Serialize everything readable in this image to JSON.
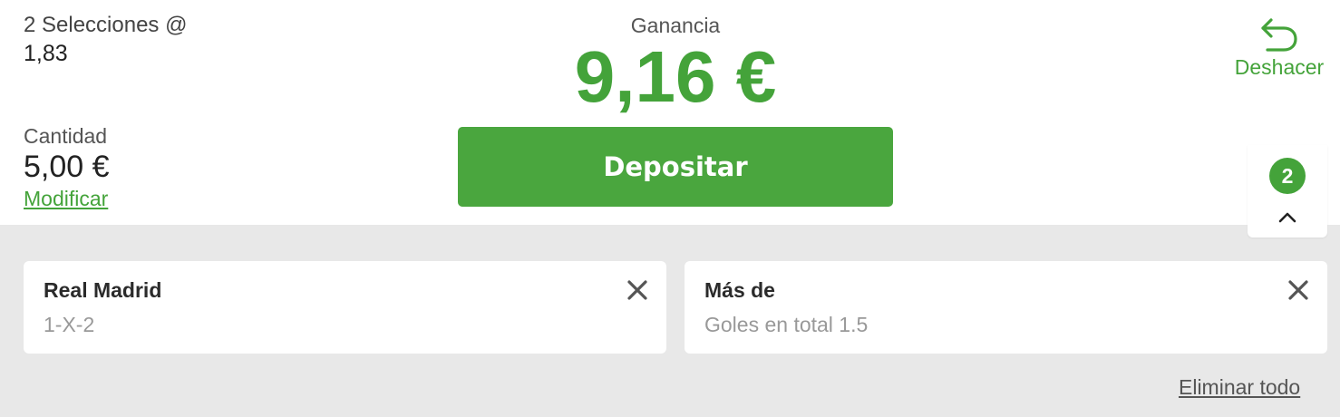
{
  "summary": {
    "selections_label": "2 Selecciones @",
    "odds": "1,83",
    "amount_label": "Cantidad",
    "amount_value": "5,00 €",
    "modify_label": "Modificar"
  },
  "winnings": {
    "label": "Ganancia",
    "value": "9,16 €"
  },
  "deposit": {
    "label": "Depositar"
  },
  "undo": {
    "icon": "undo-arrow-icon",
    "label": "Deshacer"
  },
  "collapse": {
    "count": "2",
    "icon": "chevron-up-icon"
  },
  "selections": [
    {
      "title": "Real Madrid",
      "market": "1-X-2"
    },
    {
      "title": "Más de",
      "market": "Goles en total 1.5"
    }
  ],
  "remove_all_label": "Eliminar todo",
  "colors": {
    "accent": "#44a33a",
    "button": "#4aa63e",
    "panel_background": "#e8e8e8"
  }
}
